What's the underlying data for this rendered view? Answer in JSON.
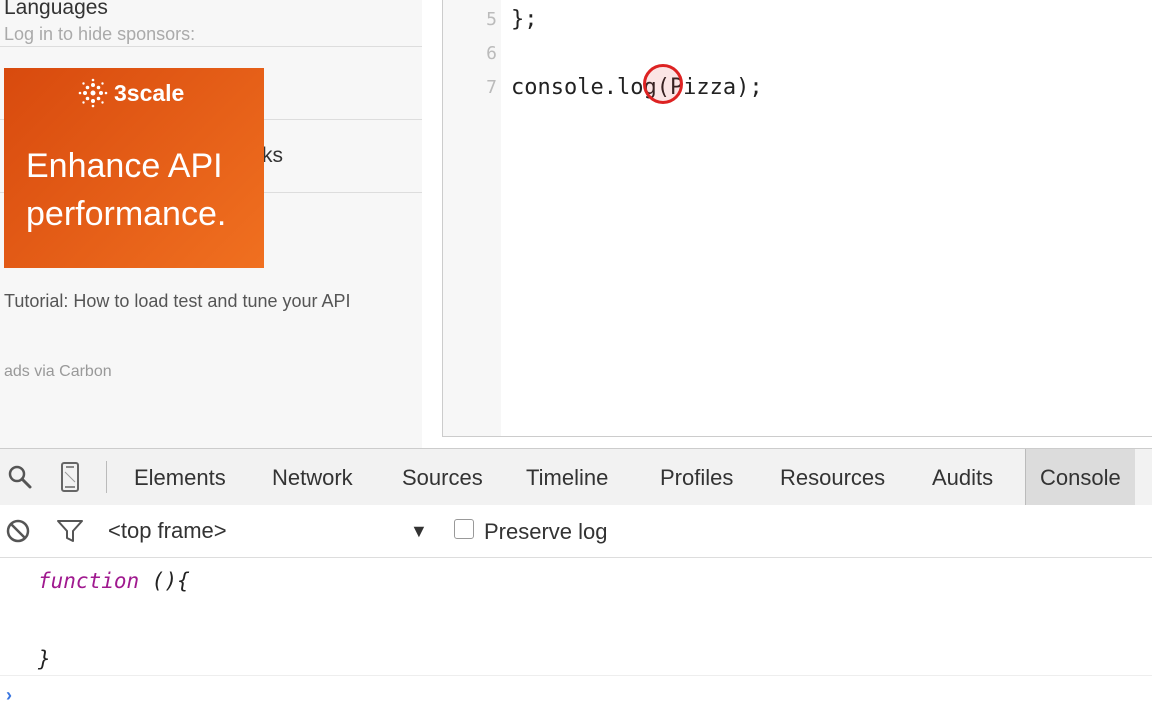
{
  "sidebar": {
    "title": "Languages",
    "login_text": "Log in to hide sponsors:",
    "hidden_item": "ks"
  },
  "ad": {
    "logo_text": "3scale",
    "headline": "Enhance API performance.",
    "description": "Tutorial: How to load test and tune your API",
    "via": "ads via Carbon"
  },
  "editor": {
    "lines": [
      {
        "number": "5",
        "code": "};"
      },
      {
        "number": "6",
        "code": ""
      },
      {
        "number": "7",
        "code": "console.log(Pizza);"
      }
    ]
  },
  "devtools": {
    "tabs": [
      "Elements",
      "Network",
      "Sources",
      "Timeline",
      "Profiles",
      "Resources",
      "Audits",
      "Console"
    ],
    "active_tab": "Console",
    "frame": "<top frame>",
    "preserve_log_label": "Preserve log",
    "preserve_log_checked": false,
    "output": {
      "keyword": "function",
      "signature": " (){",
      "close": "}"
    },
    "prompt": "›"
  },
  "colors": {
    "ad_orange": "#e35f15",
    "keyword_purple": "#a0198f",
    "prompt_blue": "#3a76e0"
  }
}
